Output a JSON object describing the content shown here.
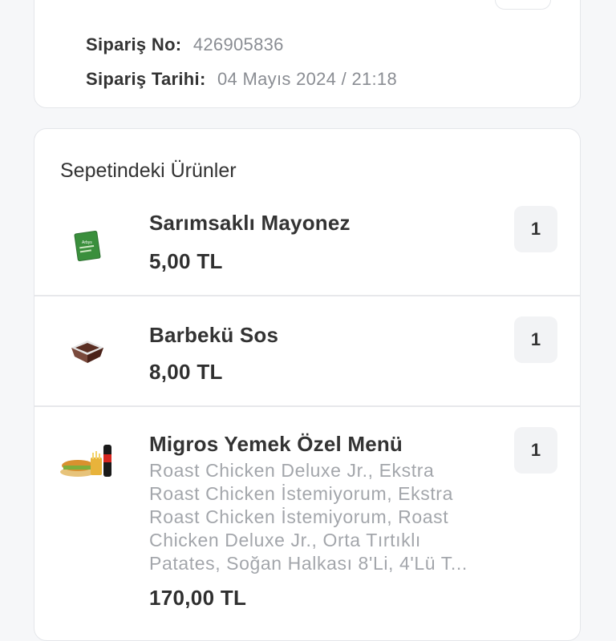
{
  "order": {
    "number_label": "Sipariş No:",
    "number_value": "426905836",
    "date_label": "Sipariş Tarihi:",
    "date_value": "04 Mayıs 2024 / 21:18"
  },
  "basket": {
    "title": "Sepetindeki Ürünler",
    "items": [
      {
        "name": "Sarımsaklı Mayonez",
        "price": "5,00 TL",
        "quantity": "1",
        "thumb_label": "Arbys",
        "icon": "mayonnaise-packet-icon"
      },
      {
        "name": "Barbekü Sos",
        "price": "8,00 TL",
        "quantity": "1",
        "icon": "bbq-sauce-cup-icon"
      },
      {
        "name": "Migros Yemek Özel Menü",
        "description_lines": [
          "Roast Chicken Deluxe Jr., Ekstra",
          "Roast Chicken İstemiyorum, Ekstra",
          "Roast Chicken İstemiyorum, Roast",
          "Chicken Deluxe Jr., Orta Tırtıklı",
          "Patates, Soğan Halkası 8'Li, 4'Lü T..."
        ],
        "price": "170,00 TL",
        "quantity": "1",
        "icon": "combo-menu-icon"
      }
    ]
  },
  "colors": {
    "background": "#f6f7f9",
    "card": "#ffffff",
    "muted_text": "#8a8d93",
    "packet_green": "#3a8f3c",
    "sauce_brown": "#5a2e22"
  }
}
